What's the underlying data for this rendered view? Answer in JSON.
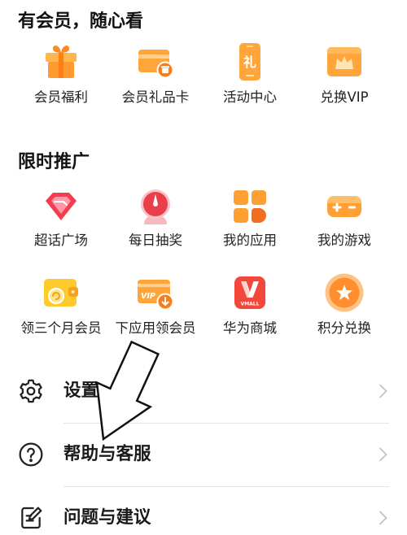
{
  "sections": [
    {
      "title": "有会员，随心看",
      "items": [
        {
          "label": "会员福利",
          "icon": "gift-box-icon"
        },
        {
          "label": "会员礼品卡",
          "icon": "gift-card-icon"
        },
        {
          "label": "活动中心",
          "icon": "activity-center-icon",
          "glyph": "礼"
        },
        {
          "label": "兑换VIP",
          "icon": "crown-icon"
        }
      ]
    },
    {
      "title": "限时推广",
      "items": [
        {
          "label": "超话广场",
          "icon": "diamond-icon"
        },
        {
          "label": "每日抽奖",
          "icon": "lottery-wheel-icon"
        },
        {
          "label": "我的应用",
          "icon": "app-grid-icon"
        },
        {
          "label": "我的游戏",
          "icon": "gamepad-icon"
        },
        {
          "label": "领三个月会员",
          "icon": "member-wallet-icon"
        },
        {
          "label": "下应用领会员",
          "icon": "vip-card-download-icon",
          "badge_text": "VIP"
        },
        {
          "label": "华为商城",
          "icon": "vmall-icon",
          "badge_text": "VMALL"
        },
        {
          "label": "积分兑换",
          "icon": "star-points-icon"
        }
      ]
    }
  ],
  "menu": [
    {
      "label": "设置",
      "icon": "gear-icon"
    },
    {
      "label": "帮助与客服",
      "icon": "help-circle-icon"
    },
    {
      "label": "问题与建议",
      "icon": "feedback-edit-icon"
    }
  ],
  "colors": {
    "background": "#FFFFFF",
    "accent_orange": "#FFA53A",
    "accent_red": "#F2473A",
    "accent_yellow": "#FFCA2C",
    "text": "#1A1A1A",
    "chevron": "#C2C2C2",
    "divider": "#E6E6E6"
  }
}
